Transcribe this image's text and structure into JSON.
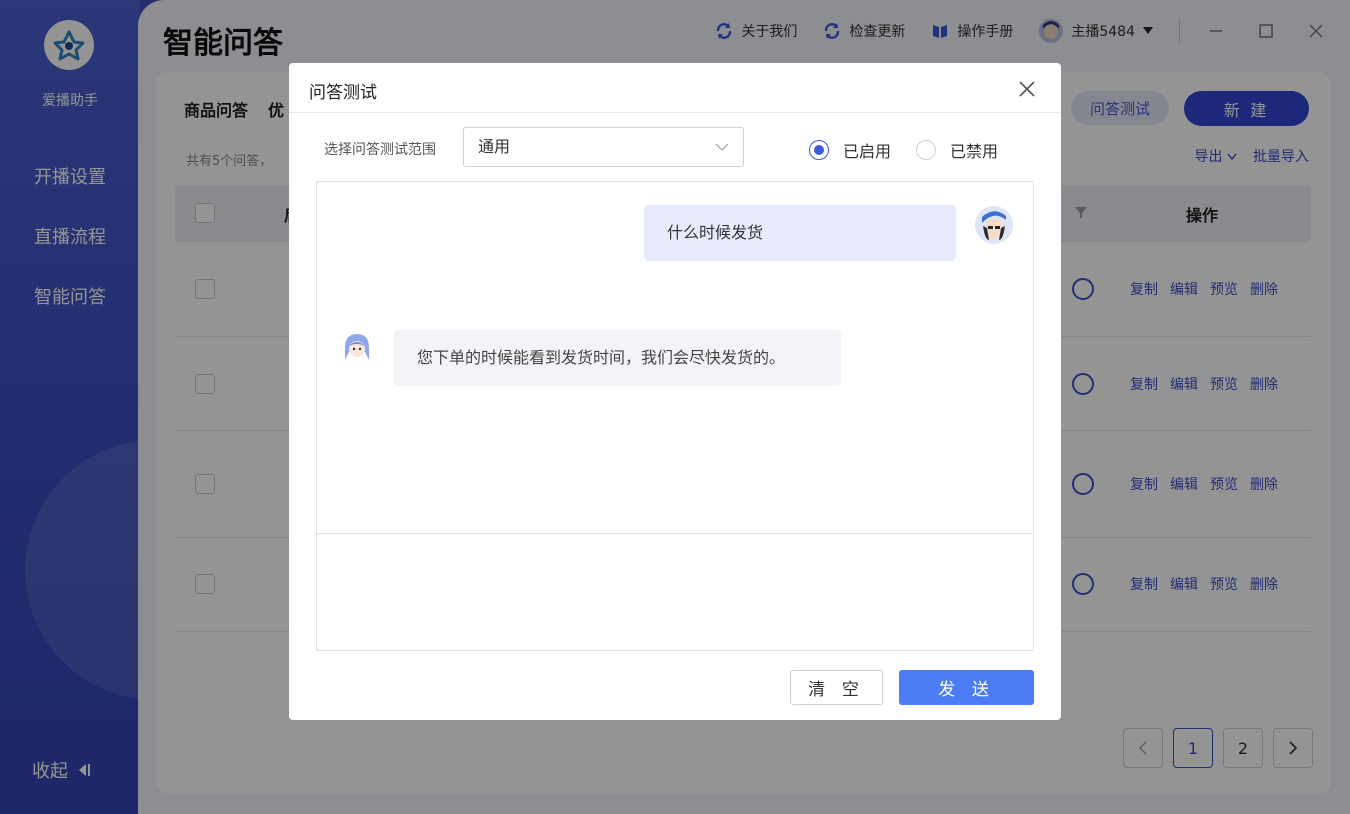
{
  "app": {
    "name": "爱播助手"
  },
  "sidebar": {
    "items": [
      {
        "label": "开播设置",
        "active": false
      },
      {
        "label": "直播流程",
        "active": false
      },
      {
        "label": "智能问答",
        "active": true
      }
    ],
    "collapse_label": "收起"
  },
  "topbar": {
    "about_label": "关于我们",
    "update_label": "检查更新",
    "manual_label": "操作手册",
    "user_name": "主播5484"
  },
  "page": {
    "title": "智能问答",
    "tabs": [
      "商品问答",
      "优"
    ],
    "count_text": "共有5个问答，",
    "qa_test_button": "问答测试",
    "new_button": "新 建",
    "export_label": "导出",
    "import_label": "批量导入",
    "table": {
      "header_partial": "后",
      "op_header": "操作",
      "row_ops": [
        "复制",
        "编辑",
        "预览",
        "删除"
      ]
    },
    "pagination": {
      "pages": [
        "1",
        "2"
      ],
      "current": "1"
    }
  },
  "dialog": {
    "title": "问答测试",
    "scope_label": "选择问答测试范围",
    "scope_value": "通用",
    "status_options": [
      {
        "label": "已启用",
        "selected": true
      },
      {
        "label": "已禁用",
        "selected": false
      }
    ],
    "messages": [
      {
        "from": "user",
        "text": "什么时候发货"
      },
      {
        "from": "bot",
        "text": "您下单的时候能看到发货时间，我们会尽快发货的。"
      }
    ],
    "input_value": "",
    "clear_button": "清 空",
    "send_button": "发 送"
  },
  "colors": {
    "sidebar": "#3f4fb8",
    "primary": "#3346d3",
    "send_button": "#4c7df5",
    "user_bubble": "#e8ebfb",
    "bot_bubble": "#f3f4f7"
  },
  "icons": [
    "refresh-icon",
    "book-icon",
    "caret-down-icon",
    "minimize-icon",
    "maximize-icon",
    "window-close-icon",
    "close-icon",
    "chevron-down-icon",
    "filter-icon",
    "collapse-left-icon"
  ]
}
